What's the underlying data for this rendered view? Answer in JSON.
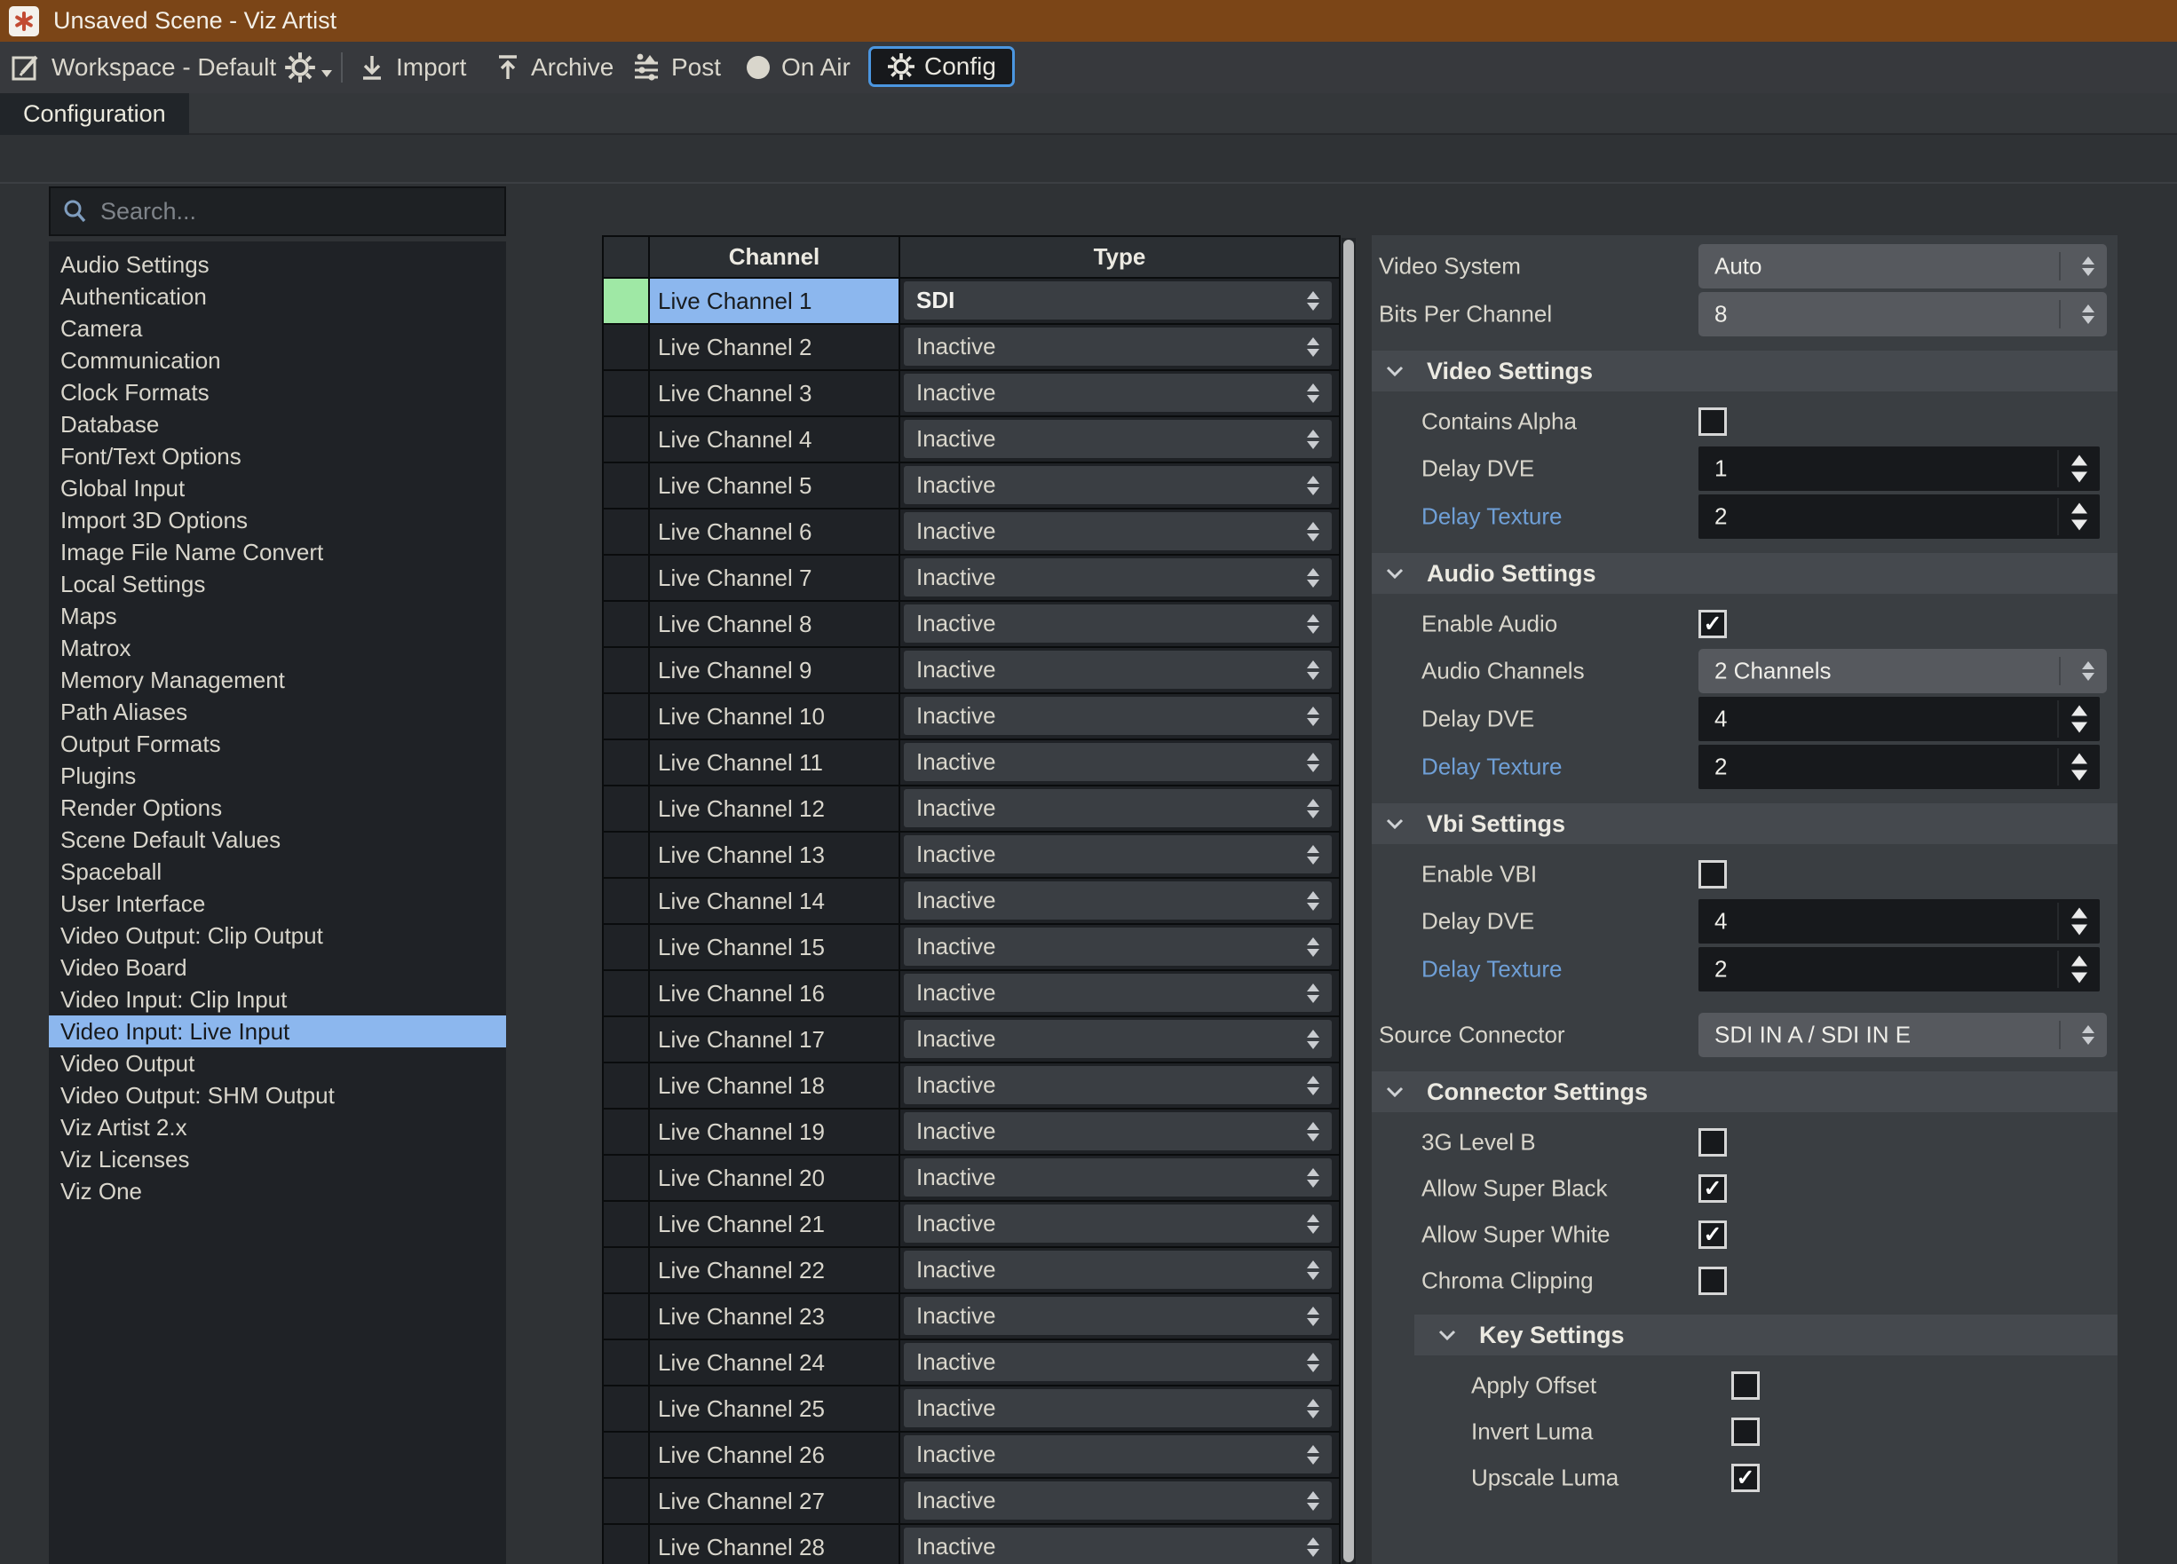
{
  "title_bar": {
    "title": "Unsaved Scene - Viz Artist"
  },
  "toolbar": {
    "workspace_label": "Workspace - Default",
    "import_label": "Import",
    "archive_label": "Archive",
    "post_label": "Post",
    "onair_label": "On Air",
    "config_label": "Config"
  },
  "tab": {
    "label": "Configuration"
  },
  "sidebar": {
    "search_placeholder": "Search...",
    "selected": "Video Input: Live Input",
    "items": [
      "Audio Settings",
      "Authentication",
      "Camera",
      "Communication",
      "Clock Formats",
      "Database",
      "Font/Text Options",
      "Global Input",
      "Import 3D Options",
      "Image File Name Convert",
      "Local Settings",
      "Maps",
      "Matrox",
      "Memory Management",
      "Path Aliases",
      "Output Formats",
      "Plugins",
      "Render Options",
      "Scene Default Values",
      "Spaceball",
      "User Interface",
      "Video Output: Clip Output",
      "Video Board",
      "Video Input: Clip Input",
      "Video Input: Live Input",
      "Video Output",
      "Video Output: SHM Output",
      "Viz Artist 2.x",
      "Viz Licenses",
      "Viz One"
    ]
  },
  "table": {
    "columns": [
      "Channel",
      "Type"
    ],
    "rows": [
      {
        "channel": "Live Channel 1",
        "type": "SDI",
        "selected": true
      },
      {
        "channel": "Live Channel 2",
        "type": "Inactive",
        "selected": false
      },
      {
        "channel": "Live Channel 3",
        "type": "Inactive",
        "selected": false
      },
      {
        "channel": "Live Channel 4",
        "type": "Inactive",
        "selected": false
      },
      {
        "channel": "Live Channel 5",
        "type": "Inactive",
        "selected": false
      },
      {
        "channel": "Live Channel 6",
        "type": "Inactive",
        "selected": false
      },
      {
        "channel": "Live Channel 7",
        "type": "Inactive",
        "selected": false
      },
      {
        "channel": "Live Channel 8",
        "type": "Inactive",
        "selected": false
      },
      {
        "channel": "Live Channel 9",
        "type": "Inactive",
        "selected": false
      },
      {
        "channel": "Live Channel 10",
        "type": "Inactive",
        "selected": false
      },
      {
        "channel": "Live Channel 11",
        "type": "Inactive",
        "selected": false
      },
      {
        "channel": "Live Channel 12",
        "type": "Inactive",
        "selected": false
      },
      {
        "channel": "Live Channel 13",
        "type": "Inactive",
        "selected": false
      },
      {
        "channel": "Live Channel 14",
        "type": "Inactive",
        "selected": false
      },
      {
        "channel": "Live Channel 15",
        "type": "Inactive",
        "selected": false
      },
      {
        "channel": "Live Channel 16",
        "type": "Inactive",
        "selected": false
      },
      {
        "channel": "Live Channel 17",
        "type": "Inactive",
        "selected": false
      },
      {
        "channel": "Live Channel 18",
        "type": "Inactive",
        "selected": false
      },
      {
        "channel": "Live Channel 19",
        "type": "Inactive",
        "selected": false
      },
      {
        "channel": "Live Channel 20",
        "type": "Inactive",
        "selected": false
      },
      {
        "channel": "Live Channel 21",
        "type": "Inactive",
        "selected": false
      },
      {
        "channel": "Live Channel 22",
        "type": "Inactive",
        "selected": false
      },
      {
        "channel": "Live Channel 23",
        "type": "Inactive",
        "selected": false
      },
      {
        "channel": "Live Channel 24",
        "type": "Inactive",
        "selected": false
      },
      {
        "channel": "Live Channel 25",
        "type": "Inactive",
        "selected": false
      },
      {
        "channel": "Live Channel 26",
        "type": "Inactive",
        "selected": false
      },
      {
        "channel": "Live Channel 27",
        "type": "Inactive",
        "selected": false
      },
      {
        "channel": "Live Channel 28",
        "type": "Inactive",
        "selected": false
      }
    ]
  },
  "panel": {
    "fields": [
      {
        "kind": "combo",
        "label": "Video System",
        "value": "Auto",
        "indent": 0
      },
      {
        "kind": "combo",
        "label": "Bits Per Channel",
        "value": "8",
        "indent": 0
      },
      {
        "kind": "section",
        "label": "Video Settings",
        "indent": 0
      },
      {
        "kind": "checkbox",
        "label": "Contains Alpha",
        "checked": false,
        "indent": 1
      },
      {
        "kind": "spin",
        "label": "Delay DVE",
        "value": "1",
        "indent": 1
      },
      {
        "kind": "spin",
        "label": "Delay Texture",
        "value": "2",
        "indent": 1,
        "label_color": "blue"
      },
      {
        "kind": "section",
        "label": "Audio Settings",
        "indent": 0
      },
      {
        "kind": "checkbox",
        "label": "Enable Audio",
        "checked": true,
        "indent": 1
      },
      {
        "kind": "combo",
        "label": "Audio Channels",
        "value": "2 Channels",
        "indent": 1
      },
      {
        "kind": "spin",
        "label": "Delay DVE",
        "value": "4",
        "indent": 1
      },
      {
        "kind": "spin",
        "label": "Delay Texture",
        "value": "2",
        "indent": 1,
        "label_color": "blue"
      },
      {
        "kind": "section",
        "label": "Vbi Settings",
        "indent": 0
      },
      {
        "kind": "checkbox",
        "label": "Enable VBI",
        "checked": false,
        "indent": 1
      },
      {
        "kind": "spin",
        "label": "Delay DVE",
        "value": "4",
        "indent": 1
      },
      {
        "kind": "spin",
        "label": "Delay Texture",
        "value": "2",
        "indent": 1,
        "label_color": "blue"
      },
      {
        "kind": "combo",
        "label": "Source Connector",
        "value": "SDI IN A / SDI IN E",
        "indent": 0
      },
      {
        "kind": "section",
        "label": "Connector Settings",
        "indent": 0
      },
      {
        "kind": "checkbox",
        "label": "3G Level B",
        "checked": false,
        "indent": 1
      },
      {
        "kind": "checkbox",
        "label": "Allow Super Black",
        "checked": true,
        "indent": 1
      },
      {
        "kind": "checkbox",
        "label": "Allow Super White",
        "checked": true,
        "indent": 1
      },
      {
        "kind": "checkbox",
        "label": "Chroma Clipping",
        "checked": false,
        "indent": 1
      },
      {
        "kind": "section",
        "label": "Key Settings",
        "indent": 1
      },
      {
        "kind": "checkbox",
        "label": "Apply Offset",
        "checked": false,
        "indent": 2
      },
      {
        "kind": "checkbox",
        "label": "Invert Luma",
        "checked": false,
        "indent": 2
      },
      {
        "kind": "checkbox",
        "label": "Upscale Luma",
        "checked": true,
        "indent": 2
      }
    ]
  },
  "colors": {
    "titlebar": "#7b4517",
    "accent_blue": "#4b96e0",
    "selection_blue": "#8cb7ee",
    "indicator_green": "#9fe8a5",
    "modified_label_blue": "#6f9fd6"
  }
}
